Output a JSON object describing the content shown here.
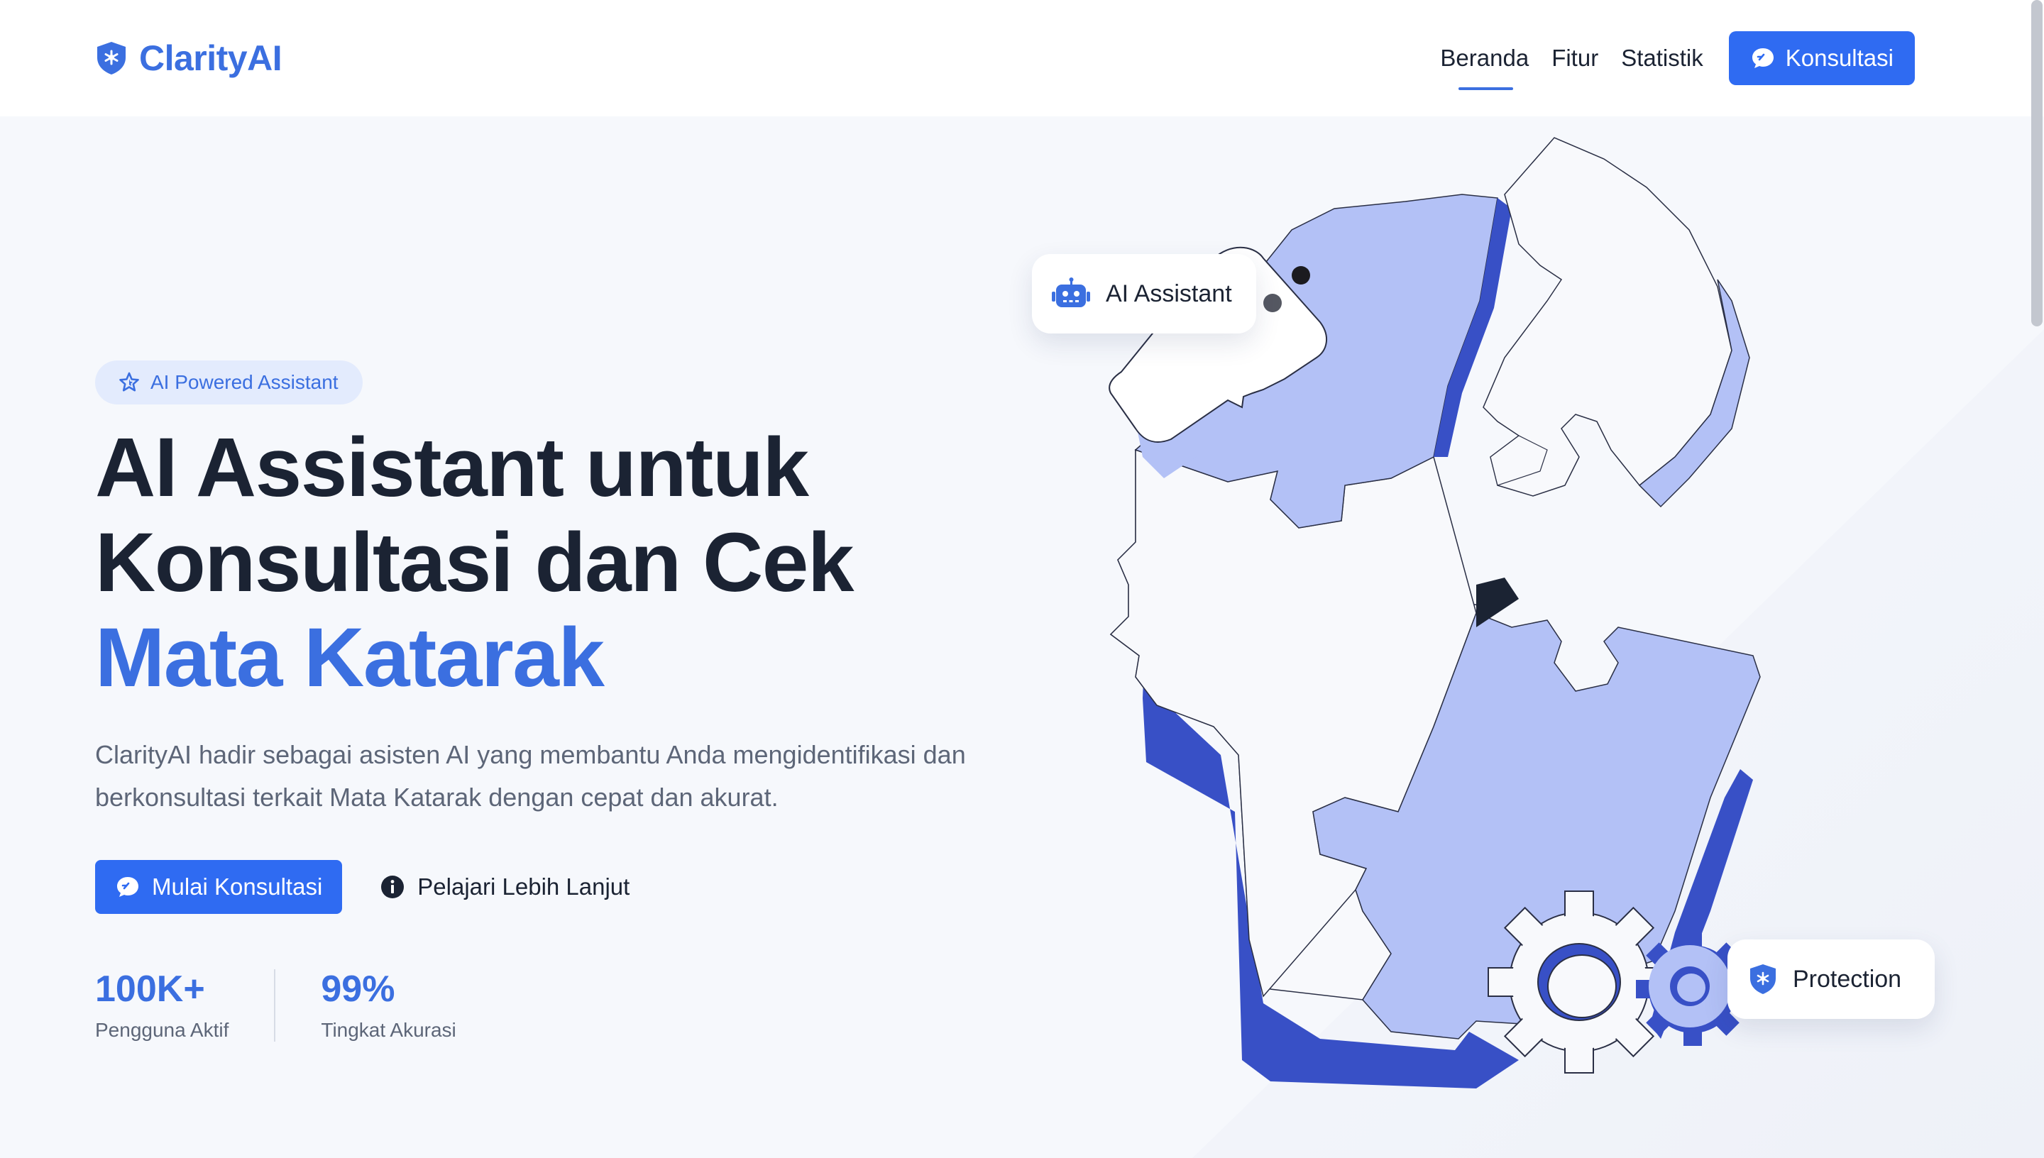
{
  "nav": {
    "brand": "ClarityAI",
    "links": [
      "Beranda",
      "Fitur",
      "Statistik"
    ],
    "active_link": "Beranda",
    "cta_label": "Konsultasi"
  },
  "hero": {
    "badge": "AI Powered Assistant",
    "title_line1": "AI Assistant untuk",
    "title_line2": "Konsultasi dan Cek",
    "title_accent": "Mata Katarak",
    "description": "ClarityAI hadir sebagai asisten AI yang membantu Anda mengidentifikasi dan berkonsultasi terkait Mata Katarak dengan cepat dan akurat.",
    "primary_button": "Mulai Konsultasi",
    "secondary_button": "Pelajari Lebih Lanjut",
    "stats": [
      {
        "value": "100K+",
        "label": "Pengguna Aktif"
      },
      {
        "value": "99%",
        "label": "Tingkat Akurasi"
      }
    ]
  },
  "illustration": {
    "card_top": "AI Assistant",
    "card_bottom": "Protection"
  },
  "colors": {
    "brand": "#3b6fe0",
    "button": "#2f6bf2",
    "heading": "#1b2333",
    "muted": "#5d6678",
    "puzzle_light": "#b3c1f6",
    "puzzle_dark": "#3850c6"
  },
  "icons": {
    "brand": "shield-star-icon",
    "cta": "chat-bubble-icon",
    "badge": "sparkle-star-icon",
    "secondary": "info-circle-icon",
    "card_top": "robot-icon",
    "card_bottom": "shield-icon"
  }
}
